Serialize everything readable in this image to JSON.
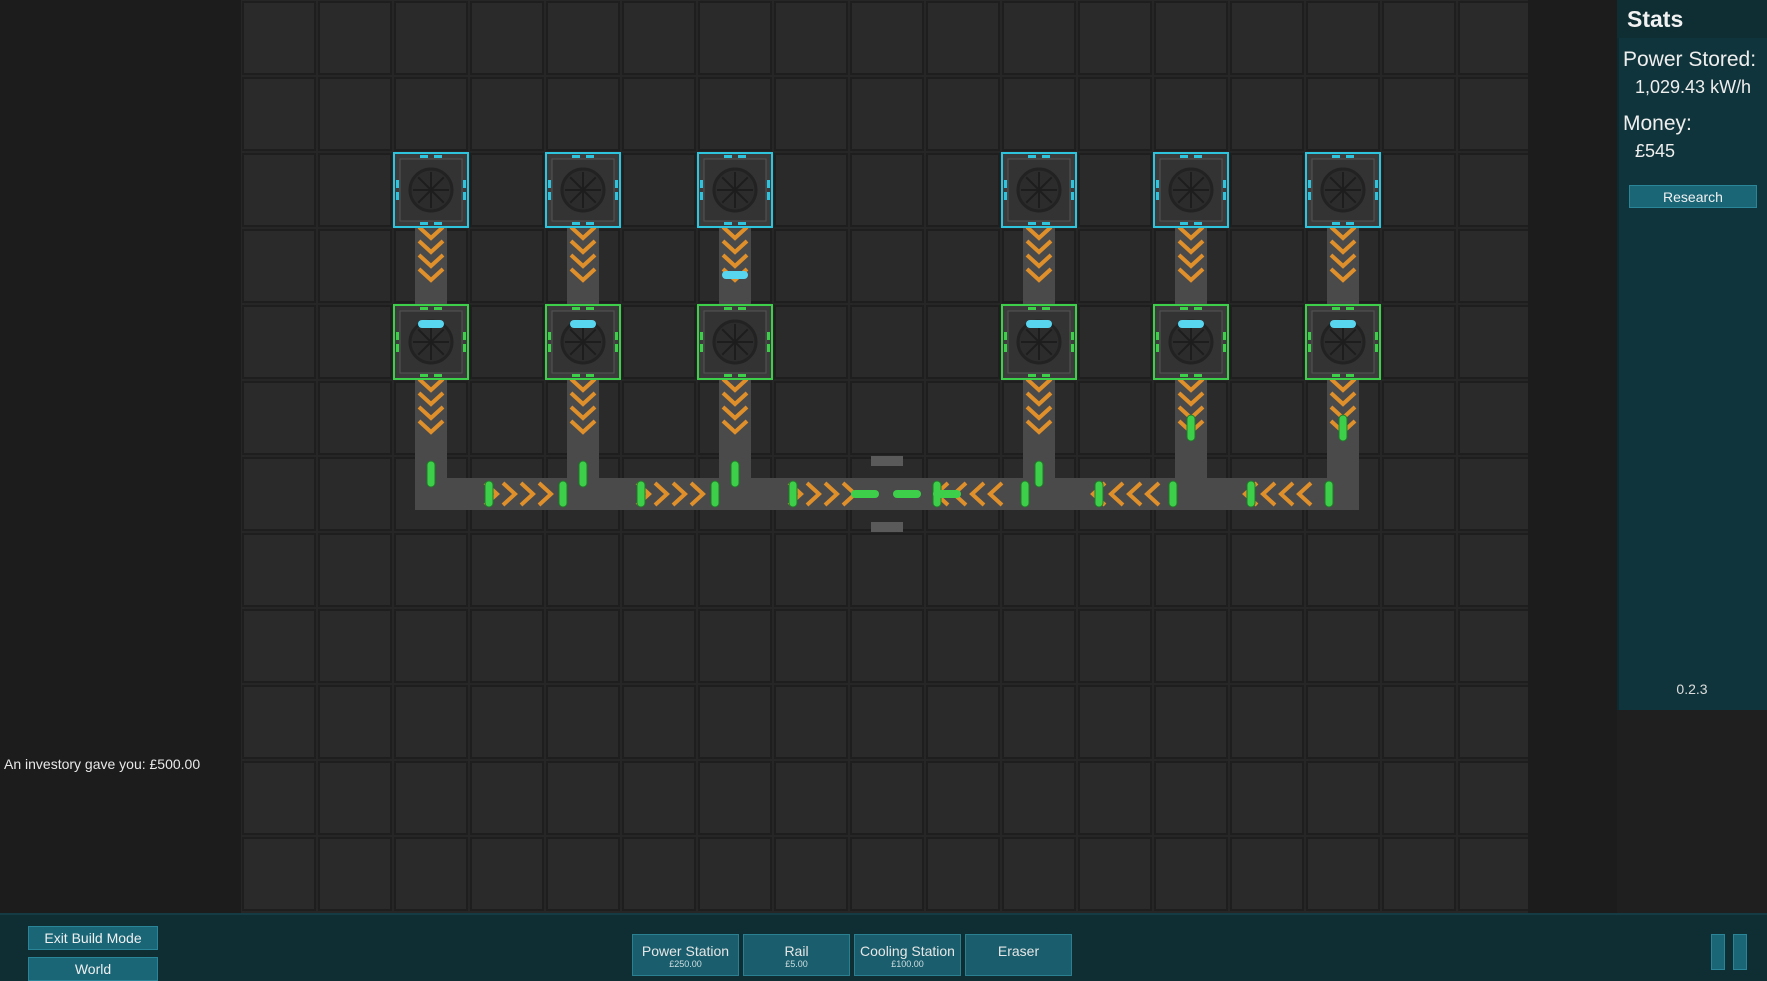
{
  "stats": {
    "title": "Stats",
    "power_label": "Power Stored:",
    "power_value": "1,029.43 kW/h",
    "money_label": "Money:",
    "money_value": "£545",
    "research_label": "Research",
    "version": "0.2.3"
  },
  "notification": "An investory gave you: £500.00",
  "side_buttons": {
    "exit_build": "Exit Build Mode",
    "world": "World"
  },
  "toolbar": {
    "items": [
      {
        "label": "Power Station",
        "price": "£250.00"
      },
      {
        "label": "Rail",
        "price": "£5.00"
      },
      {
        "label": "Cooling Station",
        "price": "£100.00"
      },
      {
        "label": "Eraser",
        "price": ""
      }
    ]
  },
  "board": {
    "cooling_stations": [
      {
        "col": 2,
        "row": 2
      },
      {
        "col": 4,
        "row": 2
      },
      {
        "col": 6,
        "row": 2
      },
      {
        "col": 10,
        "row": 2
      },
      {
        "col": 12,
        "row": 2
      },
      {
        "col": 14,
        "row": 2
      }
    ],
    "power_stations": [
      {
        "col": 2,
        "row": 4
      },
      {
        "col": 4,
        "row": 4
      },
      {
        "col": 6,
        "row": 4
      },
      {
        "col": 10,
        "row": 4
      },
      {
        "col": 12,
        "row": 4
      },
      {
        "col": 14,
        "row": 4
      }
    ],
    "colors": {
      "cooling": "#2ec4de",
      "power": "#3ecf4a",
      "rail_arrow": "#e0902a",
      "rail": "#4a4a4a"
    }
  }
}
